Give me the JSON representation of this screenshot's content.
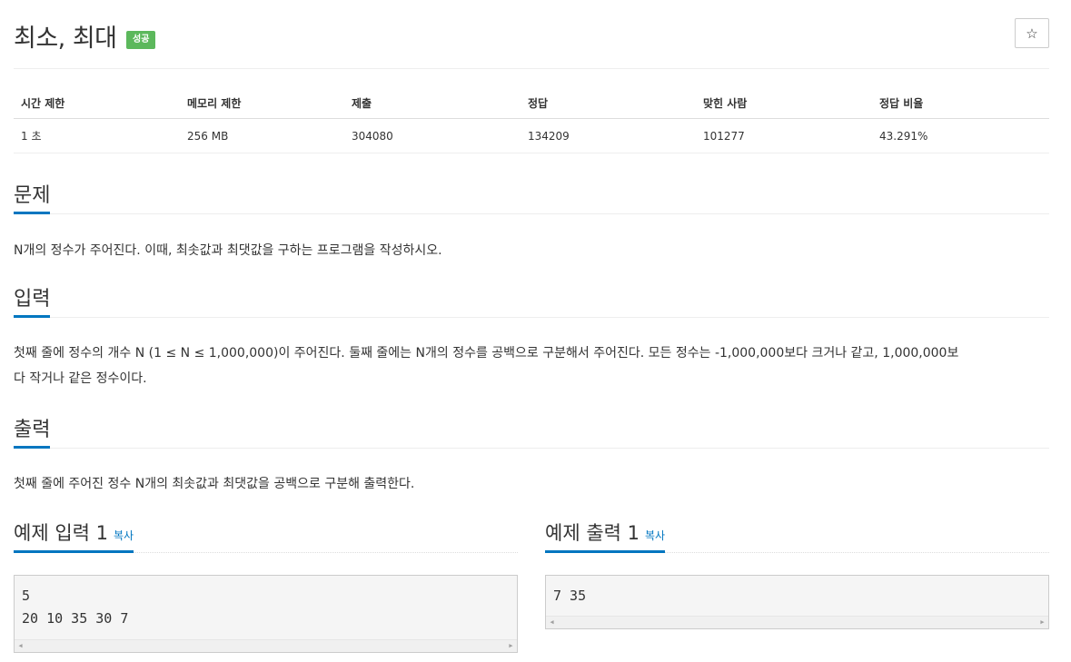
{
  "problem": {
    "title": "최소, 최대",
    "badge": "성공",
    "star_icon": "☆"
  },
  "info_table": {
    "headers": [
      "시간 제한",
      "메모리 제한",
      "제출",
      "정답",
      "맞힌 사람",
      "정답 비율"
    ],
    "values": [
      "1 초",
      "256 MB",
      "304080",
      "134209",
      "101277",
      "43.291%"
    ]
  },
  "sections": {
    "problem": {
      "heading": "문제",
      "text": "N개의 정수가 주어진다. 이때, 최솟값과 최댓값을 구하는 프로그램을 작성하시오."
    },
    "input": {
      "heading": "입력",
      "line1": "첫째 줄에 정수의 개수 N (1 ≤ N ≤ 1,000,000)이 주어진다. 둘째 줄에는 N개의 정수를 공백으로 구분해서 주어진다. 모든 정수는 -1,000,000보다 크거나 같고, 1,000,000보",
      "line2": "다 작거나 같은 정수이다."
    },
    "output": {
      "heading": "출력",
      "text": "첫째 줄에 주어진 정수 N개의 최솟값과 최댓값을 공백으로 구분해 출력한다."
    }
  },
  "samples": {
    "input": {
      "heading": "예제 입력 1",
      "copy": "복사",
      "lines": [
        "5",
        "20 10 35 30 7"
      ]
    },
    "output": {
      "heading": "예제 출력 1",
      "copy": "복사",
      "lines": [
        "7 35"
      ]
    }
  },
  "colors": {
    "accent": "#0076c0",
    "success_badge": "#5cb85c"
  }
}
